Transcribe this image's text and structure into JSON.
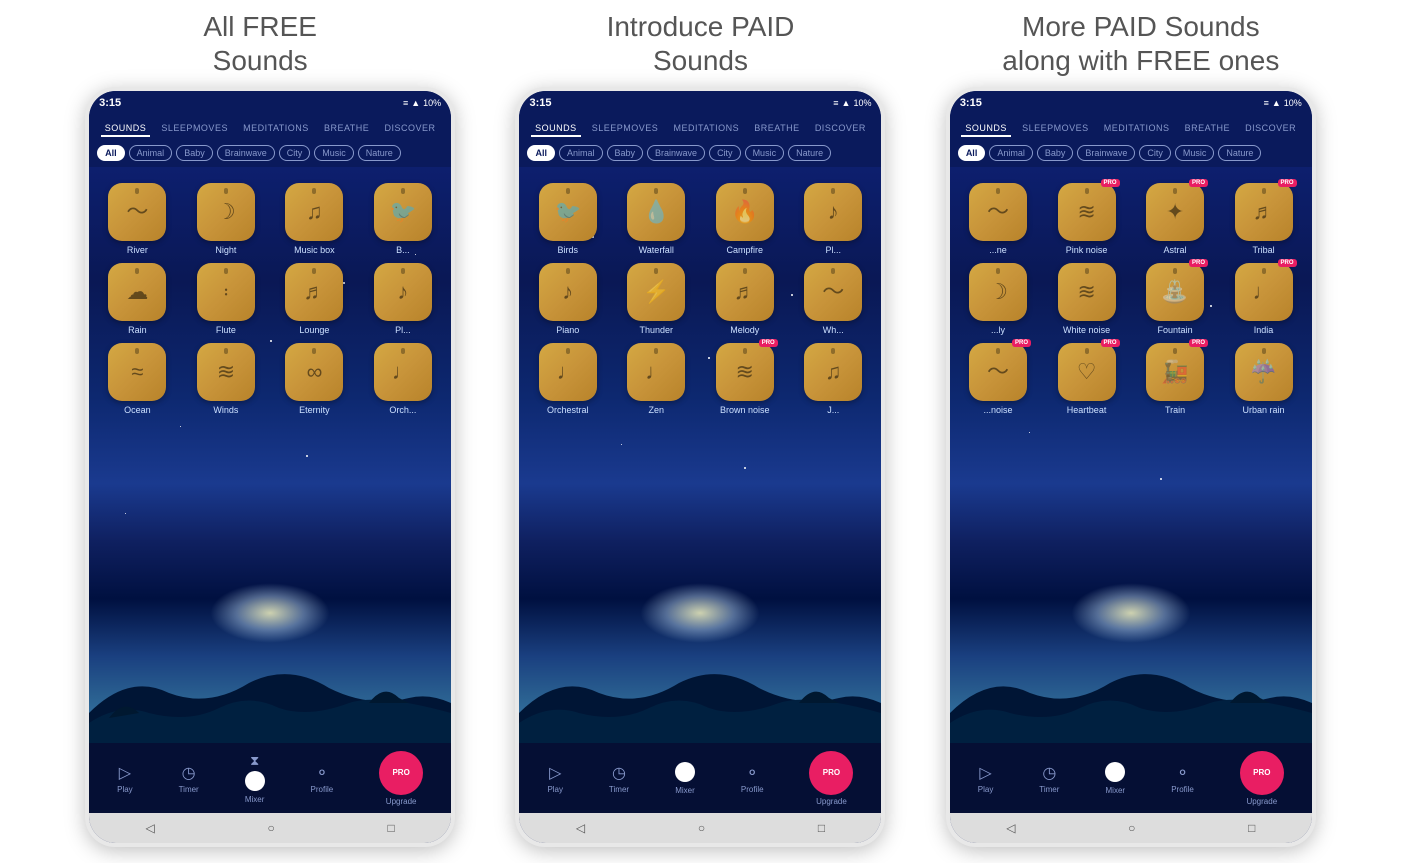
{
  "labels": {
    "col1_title": "All FREE",
    "col1_subtitle": "Sounds",
    "col2_title": "Introduce PAID",
    "col2_subtitle": "Sounds",
    "col3_title": "More PAID Sounds",
    "col3_subtitle": "along with FREE ones"
  },
  "phone": {
    "status_time": "3:15",
    "battery": "10%",
    "nav_tabs": [
      "SOUNDS",
      "SLEEPMOVES",
      "MEDITATIONS",
      "BREATHE",
      "DISCOVER"
    ],
    "active_tab": "SOUNDS",
    "categories": [
      "All",
      "Animal",
      "Baby",
      "Brainwave",
      "City",
      "Music",
      "Nature"
    ],
    "active_category": "All"
  },
  "phone1_sounds": [
    {
      "label": "River",
      "icon": "〜〜",
      "paid": false
    },
    {
      "label": "Night",
      "icon": "☽",
      "paid": false
    },
    {
      "label": "Music box",
      "icon": "♫",
      "paid": false
    },
    {
      "label": "B...",
      "icon": "♪",
      "paid": false
    },
    {
      "label": "Rain",
      "icon": "☁",
      "paid": false
    },
    {
      "label": "Flute",
      "icon": "♩",
      "paid": false
    },
    {
      "label": "Lounge",
      "icon": "♬",
      "paid": false
    },
    {
      "label": "Pl...",
      "icon": "♫",
      "paid": false
    },
    {
      "label": "Ocean",
      "icon": "⚓",
      "paid": false
    },
    {
      "label": "Winds",
      "icon": "≋",
      "paid": false
    },
    {
      "label": "Eternity",
      "icon": "∞",
      "paid": false
    },
    {
      "label": "Orch...",
      "icon": "♩",
      "paid": false
    }
  ],
  "phone2_sounds": [
    {
      "label": "Birds",
      "icon": "🐦",
      "paid": false
    },
    {
      "label": "Waterfall",
      "icon": "💧",
      "paid": false
    },
    {
      "label": "Campfire",
      "icon": "🔥",
      "paid": false
    },
    {
      "label": "Pl...",
      "icon": "♫",
      "paid": false
    },
    {
      "label": "Piano",
      "icon": "♪",
      "paid": false
    },
    {
      "label": "Thunder",
      "icon": "⚡",
      "paid": false
    },
    {
      "label": "Melody",
      "icon": "♬",
      "paid": false
    },
    {
      "label": "Wh...",
      "icon": "〜",
      "paid": false
    },
    {
      "label": "Orchestral",
      "icon": "♩",
      "paid": false
    },
    {
      "label": "Zen",
      "icon": "♩",
      "paid": false
    },
    {
      "label": "Brown noise",
      "icon": "≋",
      "paid": true
    },
    {
      "label": "J...",
      "icon": "♫",
      "paid": false
    }
  ],
  "phone3_sounds": [
    {
      "label": "...ne",
      "icon": "〜",
      "paid": false
    },
    {
      "label": "Pink noise",
      "icon": "≋",
      "paid": true
    },
    {
      "label": "Astral",
      "icon": "✦",
      "paid": true
    },
    {
      "label": "Tribal",
      "icon": "♬",
      "paid": true
    },
    {
      "label": "...ly",
      "icon": "☽",
      "paid": false
    },
    {
      "label": "White noise",
      "icon": "≋",
      "paid": false
    },
    {
      "label": "Fountain",
      "icon": "⛲",
      "paid": true
    },
    {
      "label": "India",
      "icon": "♩",
      "paid": true
    },
    {
      "label": "...noise",
      "icon": "〜",
      "paid": true
    },
    {
      "label": "Heartbeat",
      "icon": "♡",
      "paid": true
    },
    {
      "label": "Train",
      "icon": "🚂",
      "paid": true
    },
    {
      "label": "Urban rain",
      "icon": "☔",
      "paid": false
    }
  ],
  "bottom_nav": [
    "Play",
    "Timer",
    "Mixer",
    "Profile",
    "Upgrade"
  ],
  "bottom_icons": [
    "▷",
    "◷",
    "⧖",
    "👤",
    "PRO"
  ],
  "home_bar": [
    "◁",
    "○",
    "□"
  ]
}
